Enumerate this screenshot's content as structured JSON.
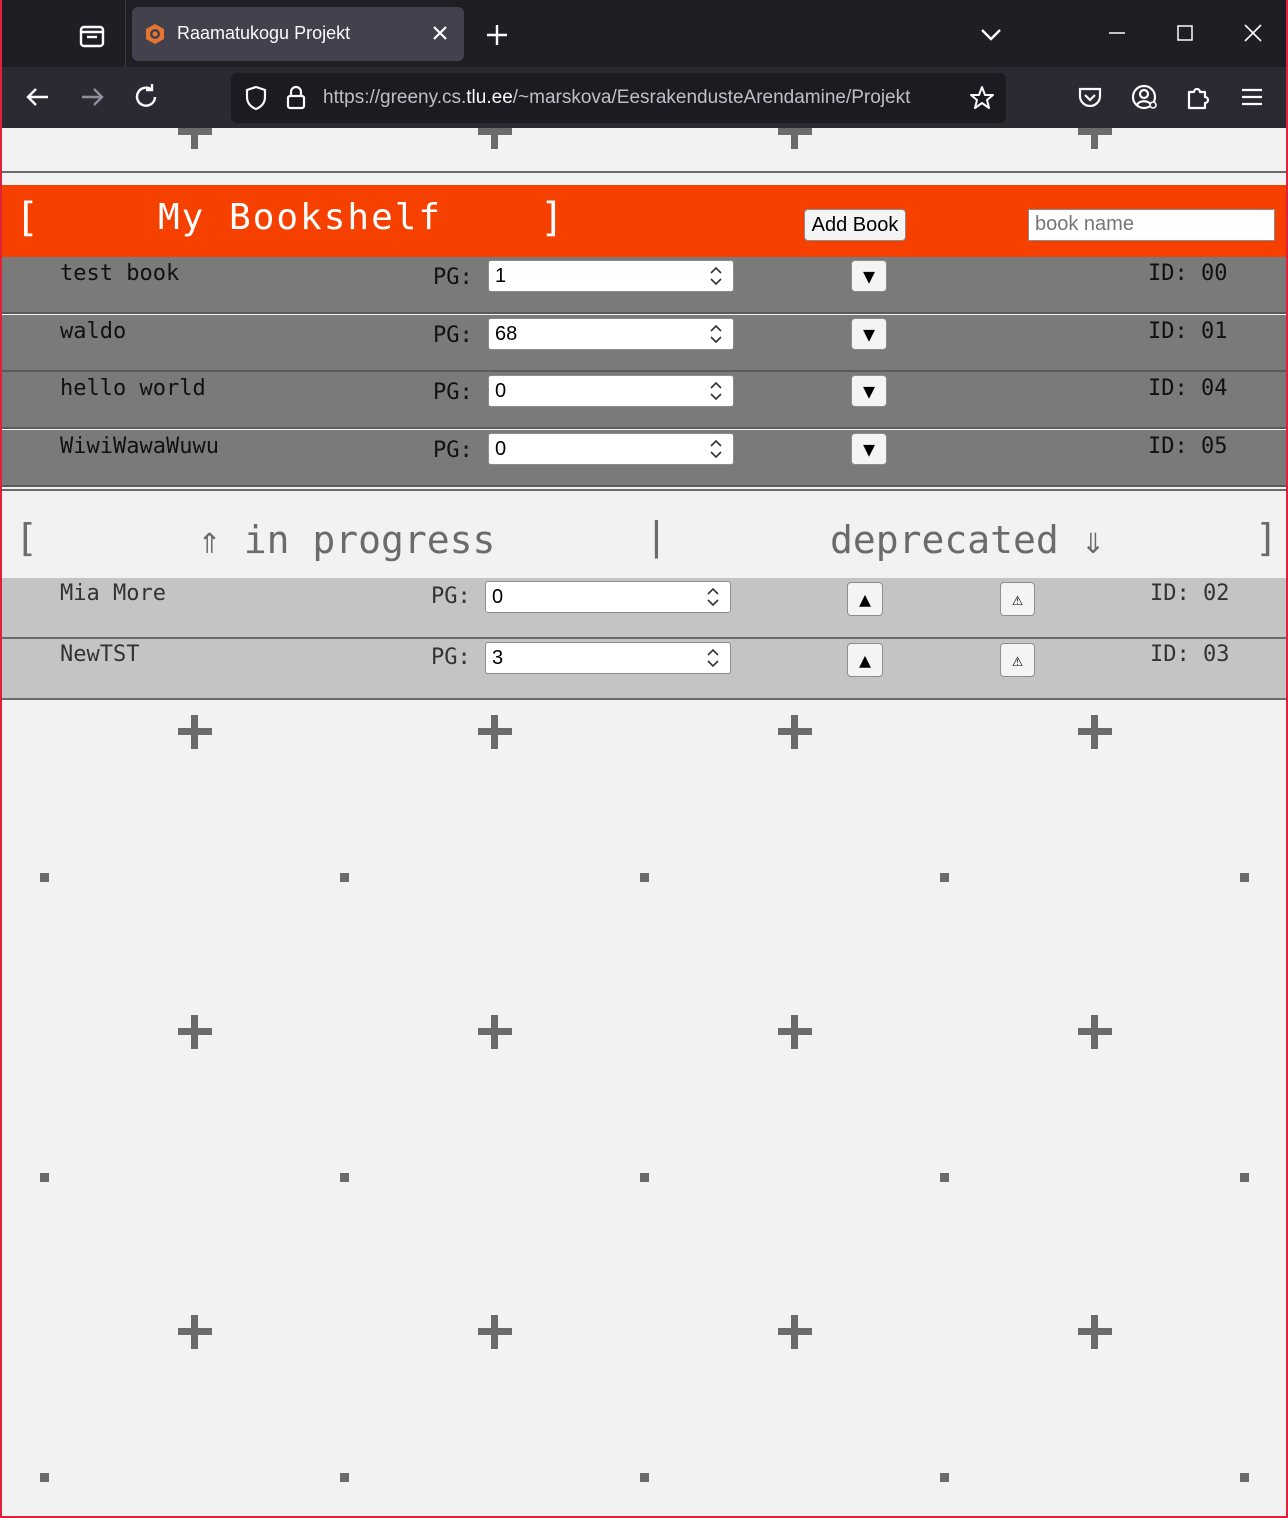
{
  "browser": {
    "tab_title": "Raamatukogu Projekt",
    "url_prefix": "https://greeny.cs.",
    "url_domain": "tlu.ee",
    "url_path": "/~marskova/EesrakendusteArendamine/Projekt"
  },
  "header": {
    "bracket_left": "[",
    "title": "My Bookshelf",
    "bracket_right": "]",
    "add_label": "Add Book",
    "input_placeholder": "book name"
  },
  "bookshelf": {
    "pg_label": "PG:",
    "move_down_symbol": "▼",
    "books": [
      {
        "name": "test book",
        "page": "1",
        "id": "ID: 00"
      },
      {
        "name": "waldo",
        "page": "68",
        "id": "ID: 01"
      },
      {
        "name": "hello world",
        "page": "0",
        "id": "ID: 04"
      },
      {
        "name": "WiwiWawaWuwu",
        "page": "0",
        "id": "ID: 05"
      }
    ]
  },
  "section_bar": {
    "bracket_left": "[",
    "in_progress": "⇑ in progress",
    "divider": "|",
    "deprecated": "deprecated ⇓",
    "bracket_right": "]"
  },
  "in_progress": {
    "pg_label": "PG:",
    "move_up_symbol": "▲",
    "deprecate_symbol": "⚠",
    "books": [
      {
        "name": "Mia More",
        "page": "0",
        "id": "ID: 02"
      },
      {
        "name": "NewTST",
        "page": "3",
        "id": "ID: 03"
      }
    ]
  },
  "colors": {
    "header_bg": "#f64000",
    "row_bg": "#7a7a7a",
    "progress_row_bg": "#c4c4c4",
    "page_bg": "#f2f2f2"
  }
}
